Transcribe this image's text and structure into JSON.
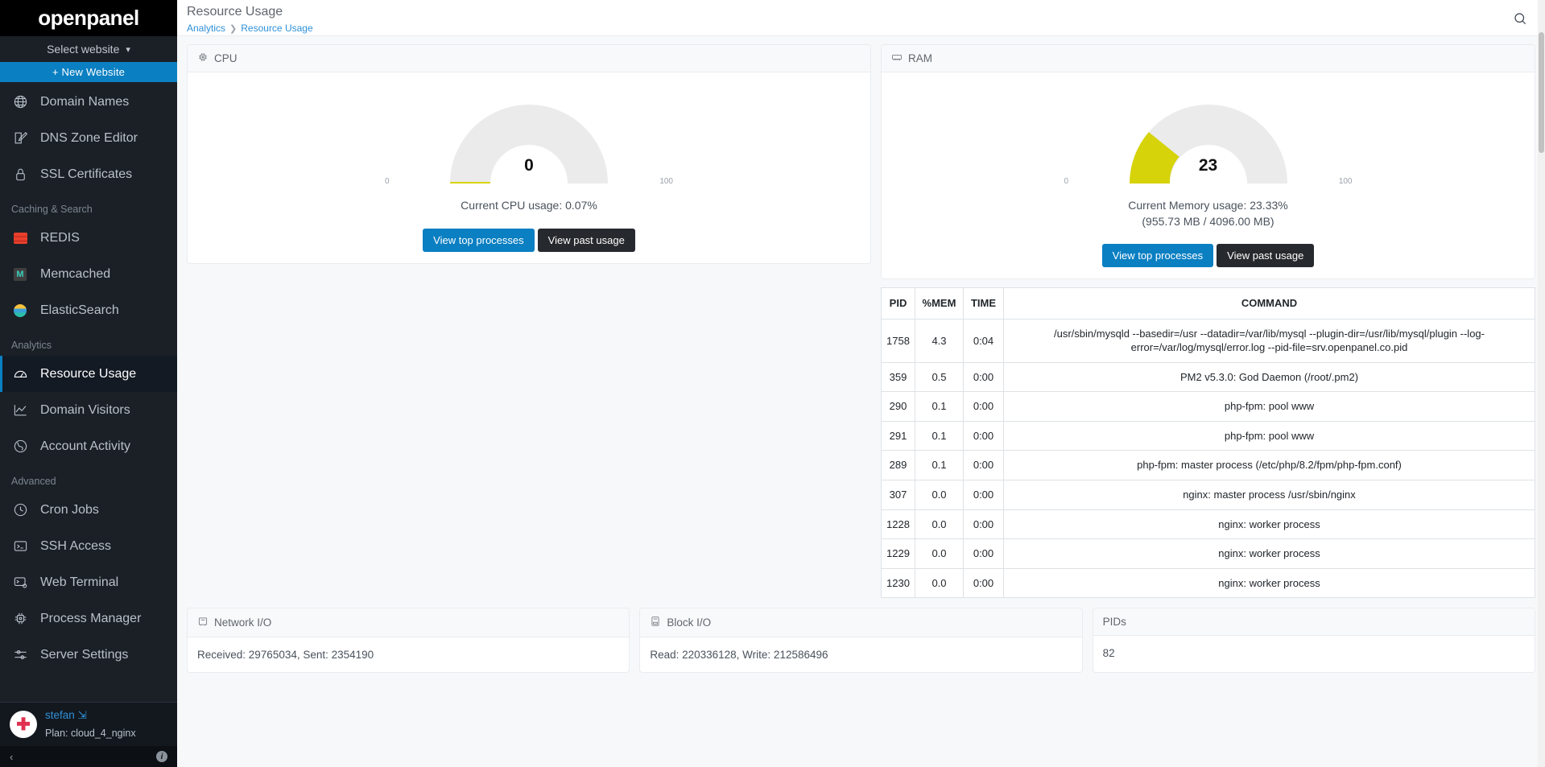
{
  "sidebar": {
    "brand": "openpanel",
    "site_select": {
      "label": "Select website",
      "chevron": "chevron-down-icon"
    },
    "new_website": "+ New Website",
    "items": [
      {
        "label": "Domain Names",
        "icon": "globe-icon",
        "active": false
      },
      {
        "label": "DNS Zone Editor",
        "icon": "edit-square-icon",
        "active": false
      },
      {
        "label": "SSL Certificates",
        "icon": "lock-icon",
        "active": false
      }
    ],
    "section_caching": "Caching & Search",
    "caching_items": [
      {
        "label": "REDIS",
        "icon": "redis-icon"
      },
      {
        "label": "Memcached",
        "icon": "memcached-icon"
      },
      {
        "label": "ElasticSearch",
        "icon": "elasticsearch-icon"
      }
    ],
    "section_analytics": "Analytics",
    "analytics_items": [
      {
        "label": "Resource Usage",
        "icon": "gauge-icon",
        "active": true
      },
      {
        "label": "Domain Visitors",
        "icon": "line-chart-icon",
        "active": false
      },
      {
        "label": "Account Activity",
        "icon": "globe-activity-icon",
        "active": false
      }
    ],
    "section_advanced": "Advanced",
    "advanced_items": [
      {
        "label": "Cron Jobs",
        "icon": "clock-icon"
      },
      {
        "label": "SSH Access",
        "icon": "terminal-icon"
      },
      {
        "label": "Web Terminal",
        "icon": "terminal-gear-icon"
      },
      {
        "label": "Process Manager",
        "icon": "cpu-chip-icon"
      },
      {
        "label": "Server Settings",
        "icon": "sliders-icon"
      }
    ],
    "user": {
      "name": "stefan",
      "logout_icon": "logout-icon",
      "plan": "Plan: cloud_4_nginx",
      "avatar": "red-cross-avatar"
    },
    "footer": {
      "collapse_icon": "chevron-left-icon",
      "info_icon": "info-icon"
    }
  },
  "topbar": {
    "title": "Resource Usage",
    "breadcrumb": [
      "Analytics",
      "Resource Usage"
    ],
    "breadcrumb_sep": "❯",
    "search_icon": "search-icon"
  },
  "cpu": {
    "card_title": "CPU",
    "card_icon": "cpu-chip-icon",
    "gauge_value": "0",
    "gauge_min": "0",
    "gauge_max": "100",
    "usage_text": "Current CPU usage: 0.07%",
    "btn_top": "View top processes",
    "btn_past": "View past usage"
  },
  "ram": {
    "card_title": "RAM",
    "card_icon": "memory-stick-icon",
    "gauge_value": "23",
    "gauge_min": "0",
    "gauge_max": "100",
    "usage_text": "Current Memory usage: 23.33%",
    "usage_text2": "(955.73 MB / 4096.00 MB)",
    "btn_top": "View top processes",
    "btn_past": "View past usage"
  },
  "process_table": {
    "columns": [
      "PID",
      "%MEM",
      "TIME",
      "COMMAND"
    ],
    "rows": [
      {
        "pid": "1758",
        "mem": "4.3",
        "time": "0:04",
        "command": "/usr/sbin/mysqld --basedir=/usr --datadir=/var/lib/mysql --plugin-dir=/usr/lib/mysql/plugin --log-error=/var/log/mysql/error.log --pid-file=srv.openpanel.co.pid"
      },
      {
        "pid": "359",
        "mem": "0.5",
        "time": "0:00",
        "command": "PM2 v5.3.0: God Daemon (/root/.pm2)"
      },
      {
        "pid": "290",
        "mem": "0.1",
        "time": "0:00",
        "command": "php-fpm: pool www"
      },
      {
        "pid": "291",
        "mem": "0.1",
        "time": "0:00",
        "command": "php-fpm: pool www"
      },
      {
        "pid": "289",
        "mem": "0.1",
        "time": "0:00",
        "command": "php-fpm: master process (/etc/php/8.2/fpm/php-fpm.conf)"
      },
      {
        "pid": "307",
        "mem": "0.0",
        "time": "0:00",
        "command": "nginx: master process /usr/sbin/nginx"
      },
      {
        "pid": "1228",
        "mem": "0.0",
        "time": "0:00",
        "command": "nginx: worker process"
      },
      {
        "pid": "1229",
        "mem": "0.0",
        "time": "0:00",
        "command": "nginx: worker process"
      },
      {
        "pid": "1230",
        "mem": "0.0",
        "time": "0:00",
        "command": "nginx: worker process"
      }
    ]
  },
  "bottom": {
    "network": {
      "title": "Network I/O",
      "icon": "network-card-icon",
      "value": "Received: 29765034, Sent: 2354190"
    },
    "block": {
      "title": "Block I/O",
      "icon": "hard-disk-icon",
      "value": "Read: 220336128, Write: 212586496"
    },
    "pids": {
      "title": "PIDs",
      "value": "82"
    }
  },
  "chart_data": [
    {
      "type": "gauge",
      "title": "CPU",
      "value": 0.07,
      "display_value": 0,
      "min": 0,
      "max": 100,
      "unit": "%",
      "arc_color": "#d6d30a",
      "track_color": "#ebebeb",
      "label": "Current CPU usage: 0.07%"
    },
    {
      "type": "gauge",
      "title": "RAM",
      "value": 23.33,
      "display_value": 23,
      "min": 0,
      "max": 100,
      "unit": "%",
      "arc_color": "#d6d30a",
      "track_color": "#ebebeb",
      "label": "Current Memory usage: 23.33%",
      "sublabel": "(955.73 MB / 4096.00 MB)"
    }
  ],
  "colors": {
    "accent": "#0a7fc2",
    "gauge_yellow": "#d6d30a",
    "gauge_track": "#ebebeb",
    "sidebar_bg": "#1b2027",
    "dark_btn": "#26292d"
  }
}
